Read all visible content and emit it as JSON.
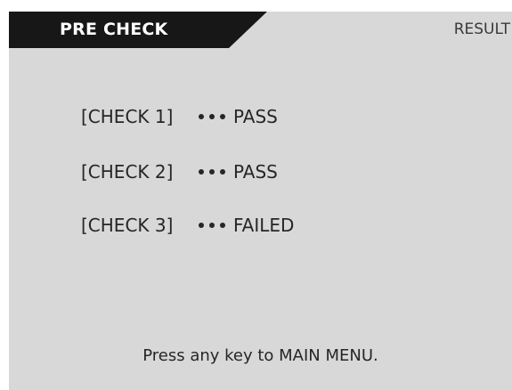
{
  "header": {
    "active_tab_label": "PRE CHECK",
    "result_tab_label": "RESULT"
  },
  "checks": [
    {
      "label": "[CHECK 1]",
      "status": "PASS"
    },
    {
      "label": "[CHECK 2]",
      "status": "PASS"
    },
    {
      "label": "[CHECK 3]",
      "status": "FAILED"
    }
  ],
  "footer": {
    "message": "Press any key to MAIN MENU."
  },
  "colors": {
    "screen_background": "#d8d8d8",
    "active_tab": "#171717",
    "text": "#262626"
  },
  "icons": {
    "separator": "ellipsis-dots-icon"
  }
}
